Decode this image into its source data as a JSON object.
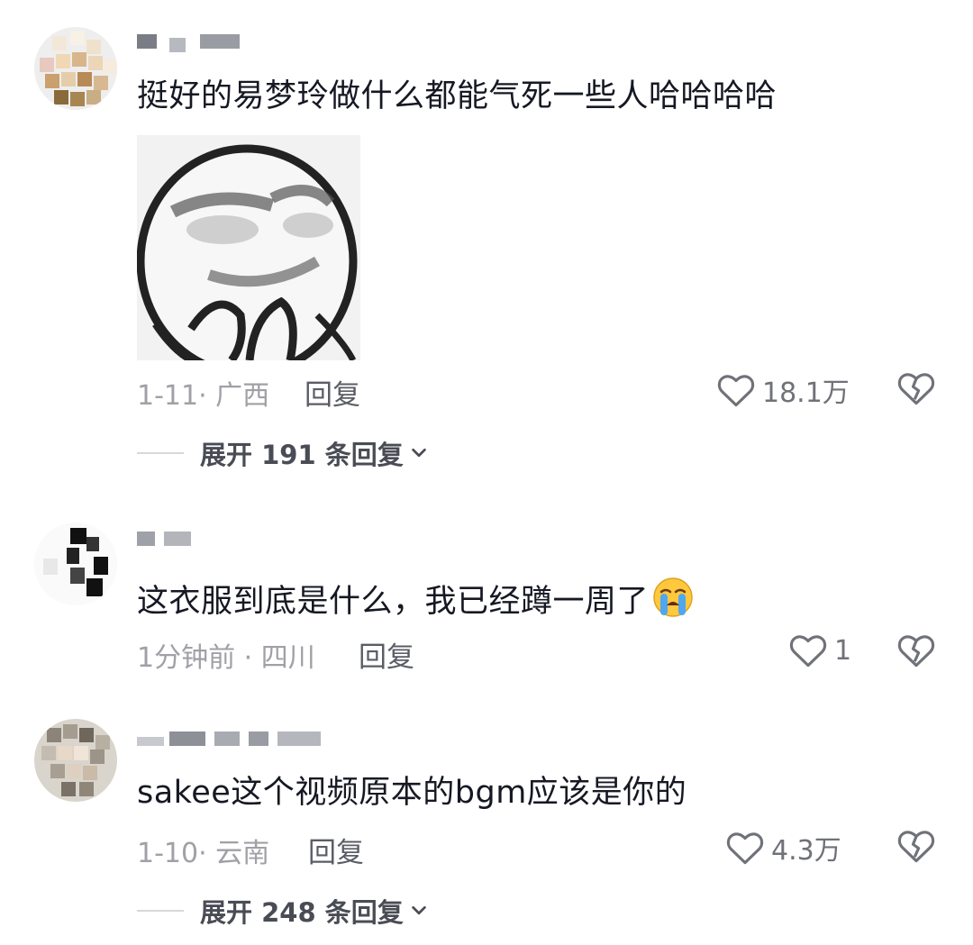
{
  "comments": [
    {
      "text": "挺好的易梦玲做什么都能气死一些人哈哈哈哈",
      "meta": "1-11· 广西",
      "reply_label": "回复",
      "likes": "18.1万",
      "expand_label": "展开 191 条回复"
    },
    {
      "text": "这衣服到底是什么，我已经蹲一周了",
      "meta": "1分钟前 · 四川",
      "reply_label": "回复",
      "likes": "1"
    },
    {
      "text": "sakee这个视频原本的bgm应该是你的",
      "meta": "1-10· 云南",
      "reply_label": "回复",
      "likes": "4.3万",
      "expand_label": "展开 248 条回复"
    }
  ],
  "icons": {
    "like": "heart-outline-icon",
    "dislike": "broken-heart-icon",
    "expand": "chevron-down-icon",
    "emoji": "loudly-crying-face-icon"
  },
  "colors": {
    "text": "#161823",
    "meta": "#a0a0a6",
    "icon": "#707279"
  }
}
